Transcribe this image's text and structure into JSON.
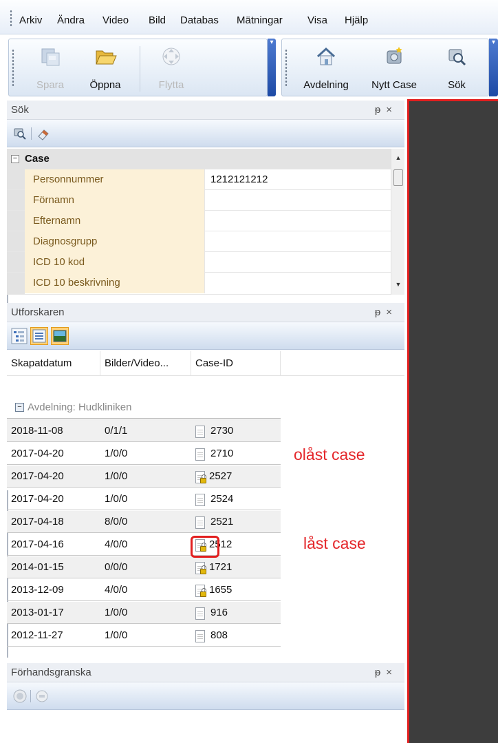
{
  "menu": [
    "Arkiv",
    "Ändra",
    "Video",
    "Bild",
    "Databas",
    "Mätningar",
    "Visa",
    "Hjälp"
  ],
  "toolbar": {
    "left": [
      {
        "label": "Spara",
        "icon": "save-icon",
        "enabled": false
      },
      {
        "label": "Öppna",
        "icon": "folder-open-icon",
        "enabled": true
      },
      {
        "label": "Flytta",
        "icon": "move-icon",
        "enabled": false
      }
    ],
    "right": [
      {
        "label": "Avdelning",
        "icon": "house-icon",
        "enabled": true
      },
      {
        "label": "Nytt Case",
        "icon": "new-case-icon",
        "enabled": true
      },
      {
        "label": "Sök",
        "icon": "search-icon",
        "enabled": true
      }
    ]
  },
  "panels": {
    "search": {
      "title": "Sök"
    },
    "explorer": {
      "title": "Utforskaren"
    },
    "preview": {
      "title": "Förhandsgranska"
    },
    "pin": "ᵽ",
    "close": "×"
  },
  "property_grid": {
    "category": "Case",
    "rows": [
      {
        "label": "Personnummer",
        "value": "1212121212"
      },
      {
        "label": "Förnamn",
        "value": ""
      },
      {
        "label": "Efternamn",
        "value": ""
      },
      {
        "label": "Diagnosgrupp",
        "value": ""
      },
      {
        "label": "ICD 10 kod",
        "value": ""
      },
      {
        "label": "ICD 10 beskrivning",
        "value": ""
      }
    ]
  },
  "list": {
    "columns": [
      "Skapatdatum",
      "Bilder/Video...",
      "Case-ID"
    ],
    "group": "Avdelning: Hudkliniken",
    "rows": [
      {
        "date": "2018-11-08",
        "media": "0/1/1",
        "id": "2730",
        "locked": false
      },
      {
        "date": "2017-04-20",
        "media": "1/0/0",
        "id": "2710",
        "locked": false
      },
      {
        "date": "2017-04-20",
        "media": "1/0/0",
        "id": "2527",
        "locked": true
      },
      {
        "date": "2017-04-20",
        "media": "1/0/0",
        "id": "2524",
        "locked": false
      },
      {
        "date": "2017-04-18",
        "media": "8/0/0",
        "id": "2521",
        "locked": false
      },
      {
        "date": "2017-04-16",
        "media": "4/0/0",
        "id": "2512",
        "locked": true
      },
      {
        "date": "2014-01-15",
        "media": "0/0/0",
        "id": "1721",
        "locked": true
      },
      {
        "date": "2013-12-09",
        "media": "4/0/0",
        "id": "1655",
        "locked": true
      },
      {
        "date": "2013-01-17",
        "media": "1/0/0",
        "id": "916",
        "locked": false
      },
      {
        "date": "2012-11-27",
        "media": "1/0/0",
        "id": "808",
        "locked": false
      }
    ]
  },
  "annotations": {
    "unlocked": "olåst case",
    "locked": "låst case"
  },
  "colors": {
    "annotation": "#e4262a",
    "dark_pane": "#3d3d3d",
    "key_bg": "#fcf1d8"
  }
}
